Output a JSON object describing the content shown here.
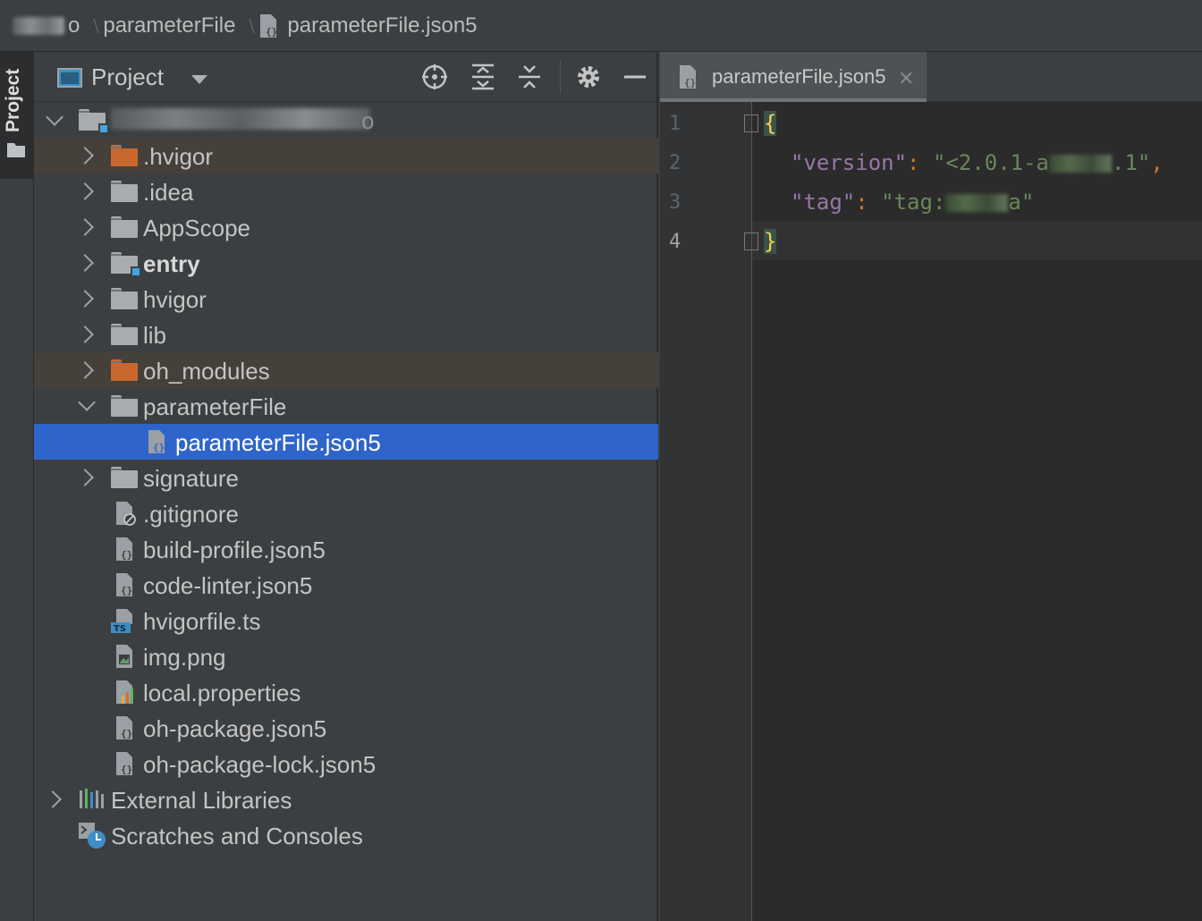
{
  "breadcrumb": {
    "root_suffix": "o",
    "folder": "parameterFile",
    "file": "parameterFile.json5"
  },
  "side_stripe": {
    "label": "Project"
  },
  "project_panel": {
    "title": "Project",
    "root_suffix": "o",
    "tree": [
      {
        "label": ".hvigor",
        "type": "folder-excluded",
        "expanded": false
      },
      {
        "label": ".idea",
        "type": "folder",
        "expanded": false
      },
      {
        "label": "AppScope",
        "type": "folder",
        "expanded": false
      },
      {
        "label": "entry",
        "type": "module",
        "expanded": false
      },
      {
        "label": "hvigor",
        "type": "folder",
        "expanded": false
      },
      {
        "label": "lib",
        "type": "folder",
        "expanded": false
      },
      {
        "label": "oh_modules",
        "type": "folder-excluded",
        "expanded": false
      },
      {
        "label": "parameterFile",
        "type": "folder",
        "expanded": true
      },
      {
        "label": "parameterFile.json5",
        "type": "json5",
        "selected": true
      },
      {
        "label": "signature",
        "type": "folder",
        "expanded": false
      },
      {
        "label": ".gitignore",
        "type": "gitignore"
      },
      {
        "label": "build-profile.json5",
        "type": "json5"
      },
      {
        "label": "code-linter.json5",
        "type": "json5"
      },
      {
        "label": "hvigorfile.ts",
        "type": "ts"
      },
      {
        "label": "img.png",
        "type": "image"
      },
      {
        "label": "local.properties",
        "type": "properties"
      },
      {
        "label": "oh-package.json5",
        "type": "json5"
      },
      {
        "label": "oh-package-lock.json5",
        "type": "json5"
      },
      {
        "label": "External Libraries",
        "type": "libraries"
      },
      {
        "label": "Scratches and Consoles",
        "type": "scratches"
      }
    ]
  },
  "editor": {
    "tab_label": "parameterFile.json5",
    "line_numbers": [
      "1",
      "2",
      "3",
      "4"
    ],
    "lines": {
      "open_brace": "{",
      "version_key": "\"version\"",
      "version_colon": ":",
      "version_value_start": "\"<2.0.1-a",
      "version_value_end": ".1\"",
      "version_comma": ",",
      "tag_key": "\"tag\"",
      "tag_colon": ":",
      "tag_value_start": "\"tag:",
      "tag_value_end": "a\"",
      "close_brace": "}"
    }
  },
  "colors": {
    "panel_bg": "#3c3f41",
    "editor_bg": "#2b2b2b",
    "selection": "#2f65ca",
    "excluded_row": "#45413a",
    "json_key": "#9876aa",
    "json_string": "#6a8759",
    "json_punct": "#cc7832",
    "brace": "#f2d648"
  }
}
